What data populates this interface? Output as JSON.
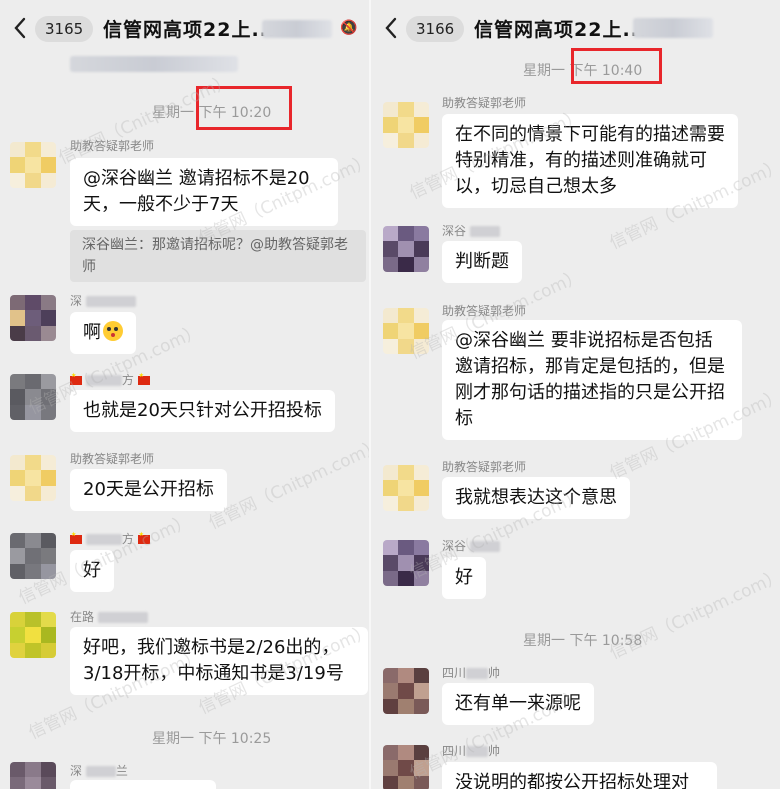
{
  "left": {
    "header": {
      "badge": "3165",
      "title": "信管网高项22上..."
    },
    "timestamps": [
      "星期一 下午 10:20",
      "星期一 下午 10:25"
    ],
    "senders": {
      "teacher": "助教答疑郭老师",
      "s2": "深",
      "s3_end": "方",
      "s4_end": "方",
      "s5": "在路",
      "s6": "深",
      "s6_end": "兰"
    },
    "messages": {
      "m1": "@深谷幽兰 邀请招标不是20天，一般不少于7天",
      "m1_quote": "深谷幽兰：那邀请招标呢？@助教答疑郭老师",
      "m2": "啊",
      "m3": "也就是20天只针对公开招投标",
      "m4": "20天是公开招标",
      "m5": "好",
      "m6": "好吧，我们邀标书是2/26出的，3/18开标，中标通知书是3/19号"
    }
  },
  "right": {
    "header": {
      "badge": "3166",
      "title": "信管网高项22上..."
    },
    "timestamps": [
      "星期一 下午 10:40",
      "星期一 下午 10:58"
    ],
    "senders": {
      "teacher": "助教答疑郭老师",
      "s2": "深谷",
      "s3": "四川",
      "s3_end": "帅",
      "s4": "四川",
      "s4_end": "帅"
    },
    "messages": {
      "m1": "在不同的情景下可能有的描述需要特别精准，有的描述则准确就可以，切忌自己想太多",
      "m2": "判断题",
      "m3": "@深谷幽兰 要非说招标是否包括邀请招标，那肯定是包括的，但是刚才那句话的描述指的只是公开招标",
      "m4": "我就想表达这个意思",
      "m5": "好",
      "m6": "还有单一来源呢",
      "m7": "没说明的都按公开招标处理对"
    }
  },
  "watermark": "信管网（Cnitpm.com）",
  "colors": {
    "background": "#ededed",
    "bubble": "#ffffff",
    "highlight": "#e8262b",
    "timestamp": "#9a9a9a"
  }
}
